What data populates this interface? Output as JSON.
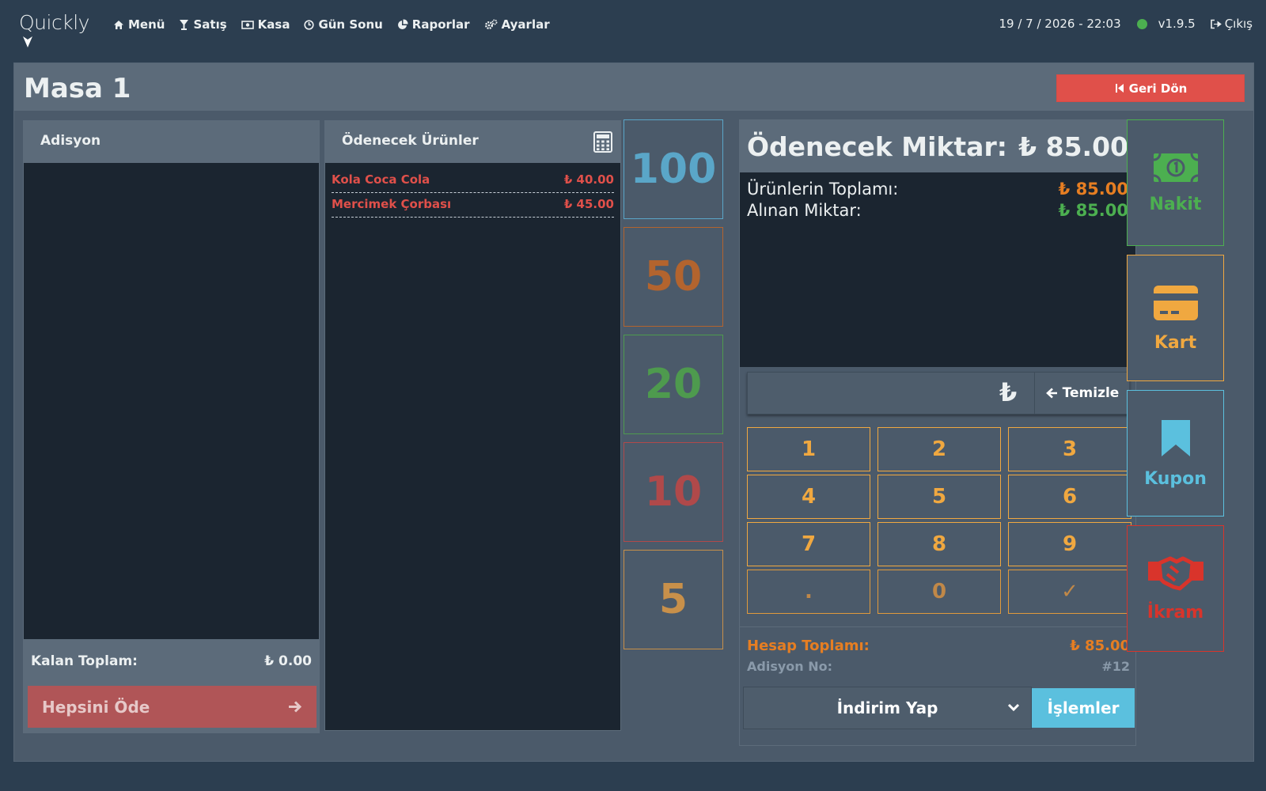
{
  "app": {
    "logo": "Quickly"
  },
  "nav": [
    {
      "label": "Menü",
      "icon": "home-icon"
    },
    {
      "label": "Satış",
      "icon": "glass-icon"
    },
    {
      "label": "Kasa",
      "icon": "money-icon"
    },
    {
      "label": "Gün Sonu",
      "icon": "clock-icon"
    },
    {
      "label": "Raporlar",
      "icon": "pie-chart-icon"
    },
    {
      "label": "Ayarlar",
      "icon": "gears-icon"
    }
  ],
  "header_right": {
    "datetime": "19 / 7 / 2026 - 22:03",
    "status_color": "#4caf50",
    "version": "v1.9.5",
    "logout_label": "Çıkış"
  },
  "page": {
    "title": "Masa 1",
    "back_label": "Geri Dön"
  },
  "adisyon": {
    "header": "Adisyon",
    "items": [],
    "remaining_label": "Kalan Toplam:",
    "remaining_value": "₺ 0.00",
    "pay_all_label": "Hepsini Öde"
  },
  "to_pay": {
    "header": "Ödenecek Ürünler",
    "items": [
      {
        "name": "Kola Coca Cola",
        "price": "₺ 40.00"
      },
      {
        "name": "Mercimek Çorbası",
        "price": "₺ 45.00"
      }
    ]
  },
  "quick_amounts": [
    {
      "label": "100",
      "color": "#5aa6c8"
    },
    {
      "label": "50",
      "color": "#b3642e"
    },
    {
      "label": "20",
      "color": "#4e9a4e"
    },
    {
      "label": "10",
      "color": "#b0494a"
    },
    {
      "label": "5",
      "color": "#c8904a"
    }
  ],
  "payment": {
    "title": "Ödenecek Miktar:",
    "amount": "₺ 85.00",
    "products_total_label": "Ürünlerin Toplamı:",
    "products_total_value": "₺ 85.00",
    "received_label": "Alınan Miktar:",
    "received_value": "₺ 85.00",
    "input_value": "",
    "currency_symbol": "₺",
    "clear_label": "Temizle",
    "keys": [
      "1",
      "2",
      "3",
      "4",
      "5",
      "6",
      "7",
      "8",
      "9",
      ".",
      "0",
      "✓"
    ],
    "bill_total_label": "Hesap Toplamı:",
    "bill_total_value": "₺ 85.00",
    "bill_no_label": "Adisyon No:",
    "bill_no_value": "#12",
    "discount_label": "İndirim Yap",
    "operations_label": "İşlemler"
  },
  "methods": [
    {
      "label": "Nakit",
      "icon": "cash-icon",
      "color": "#4caf50"
    },
    {
      "label": "Kart",
      "icon": "credit-card-icon",
      "color": "#f0a840"
    },
    {
      "label": "Kupon",
      "icon": "bookmark-icon",
      "color": "#5bc0de"
    },
    {
      "label": "İkram",
      "icon": "handshake-icon",
      "color": "#d9342b"
    }
  ],
  "colors": {
    "accent_orange": "#e67e22",
    "accent_green": "#4caf50",
    "danger": "#e0504a",
    "info": "#5bc0de"
  }
}
